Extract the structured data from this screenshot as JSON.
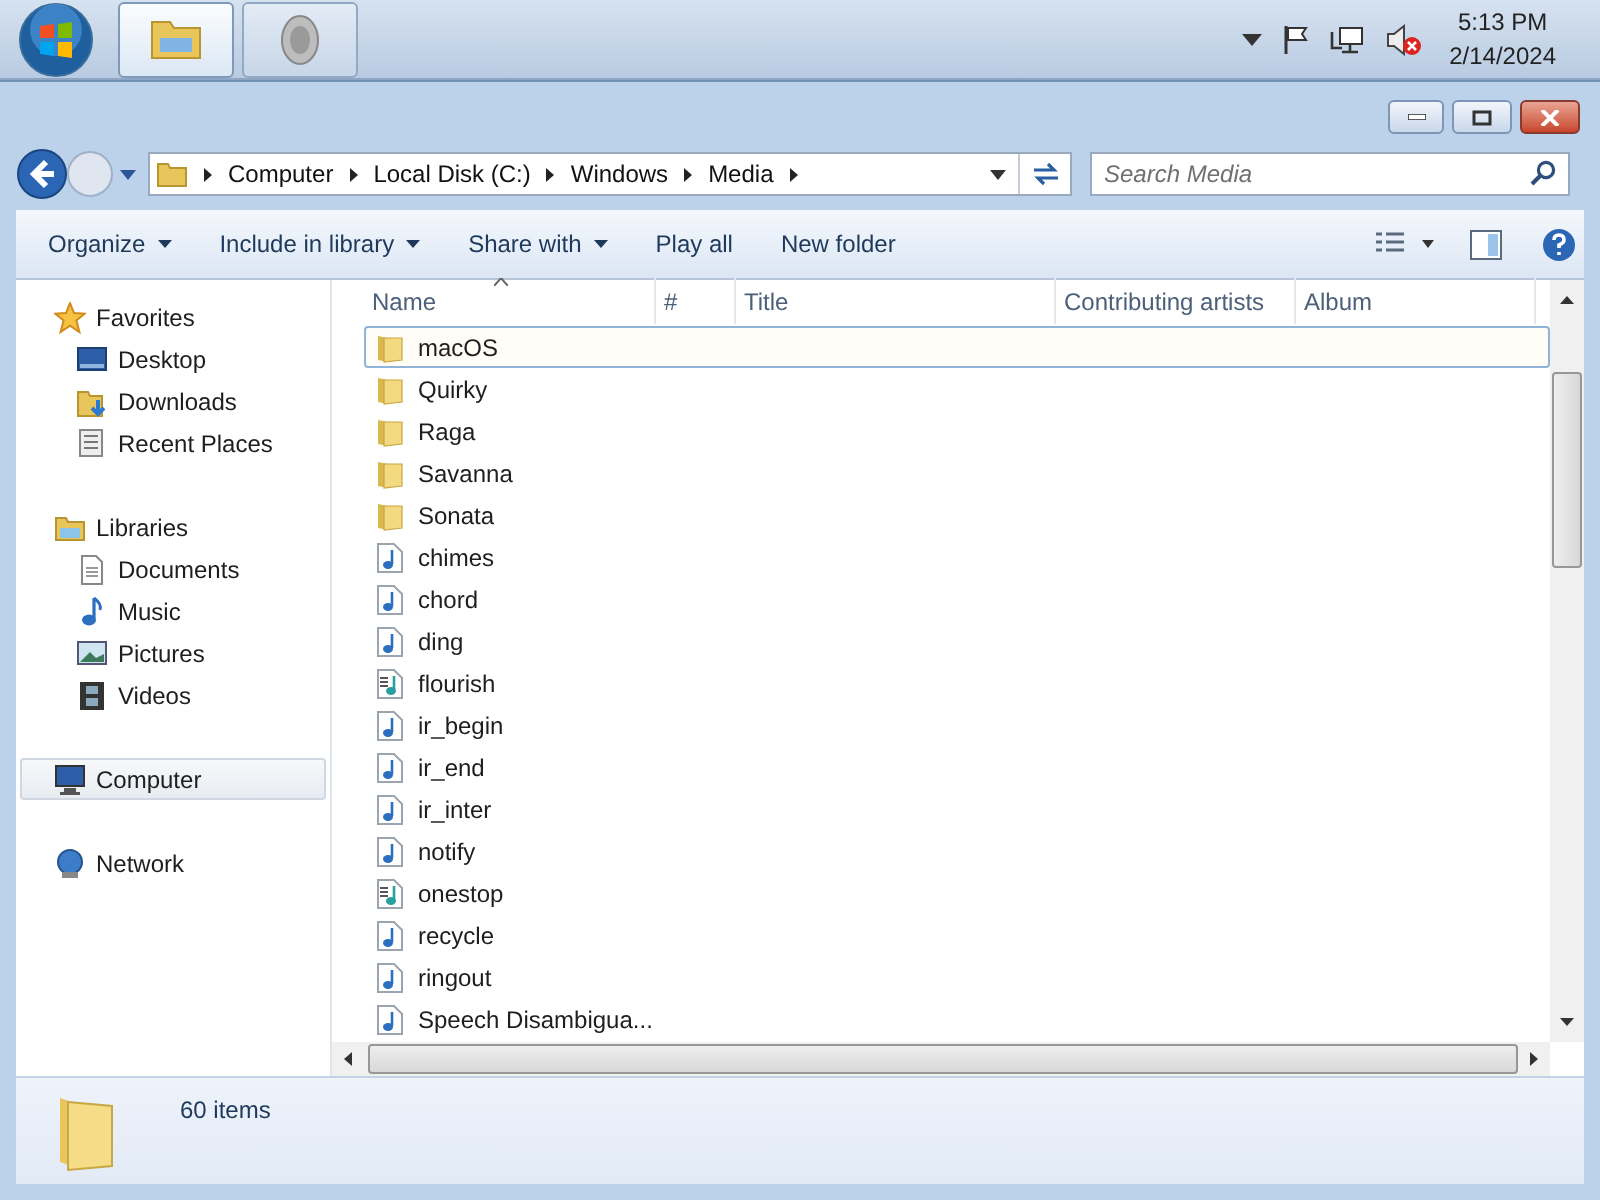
{
  "taskbar": {
    "buttons": [
      {
        "kind": "explorer",
        "active": true
      },
      {
        "kind": "speaker",
        "active": false
      }
    ],
    "clock": {
      "time": "5:13 PM",
      "date": "2/14/2024"
    }
  },
  "breadcrumb": [
    "Computer",
    "Local Disk (C:)",
    "Windows",
    "Media"
  ],
  "search": {
    "placeholder": "Search Media"
  },
  "toolbar": {
    "buttons": [
      {
        "label": "Organize",
        "dropdown": true
      },
      {
        "label": "Include in library",
        "dropdown": true
      },
      {
        "label": "Share with",
        "dropdown": true
      },
      {
        "label": "Play all",
        "dropdown": false
      },
      {
        "label": "New folder",
        "dropdown": false
      }
    ]
  },
  "sidebar": {
    "groups": [
      {
        "label": "Favorites",
        "kind": "star",
        "selected": false,
        "children": [
          {
            "label": "Desktop",
            "kind": "desktop"
          },
          {
            "label": "Downloads",
            "kind": "downloads"
          },
          {
            "label": "Recent Places",
            "kind": "recent"
          }
        ]
      },
      {
        "label": "Libraries",
        "kind": "libraries",
        "selected": false,
        "children": [
          {
            "label": "Documents",
            "kind": "document"
          },
          {
            "label": "Music",
            "kind": "music"
          },
          {
            "label": "Pictures",
            "kind": "pictures"
          },
          {
            "label": "Videos",
            "kind": "videos"
          }
        ]
      },
      {
        "label": "Computer",
        "kind": "computer",
        "selected": true
      },
      {
        "label": "Network",
        "kind": "network",
        "selected": false
      }
    ]
  },
  "columns": [
    {
      "label": "Name",
      "sorted": true
    },
    {
      "label": "#",
      "sorted": false
    },
    {
      "label": "Title",
      "sorted": false
    },
    {
      "label": "Contributing artists",
      "sorted": false
    },
    {
      "label": "Album",
      "sorted": false
    }
  ],
  "files": [
    {
      "name": "macOS",
      "kind": "folder",
      "focused": true
    },
    {
      "name": "Quirky",
      "kind": "folder",
      "focused": false
    },
    {
      "name": "Raga",
      "kind": "folder",
      "focused": false
    },
    {
      "name": "Savanna",
      "kind": "folder",
      "focused": false
    },
    {
      "name": "Sonata",
      "kind": "folder",
      "focused": false
    },
    {
      "name": "chimes",
      "kind": "audio",
      "focused": false
    },
    {
      "name": "chord",
      "kind": "audio",
      "focused": false
    },
    {
      "name": "ding",
      "kind": "audio",
      "focused": false
    },
    {
      "name": "flourish",
      "kind": "midi",
      "focused": false
    },
    {
      "name": "ir_begin",
      "kind": "audio",
      "focused": false
    },
    {
      "name": "ir_end",
      "kind": "audio",
      "focused": false
    },
    {
      "name": "ir_inter",
      "kind": "audio",
      "focused": false
    },
    {
      "name": "notify",
      "kind": "audio",
      "focused": false
    },
    {
      "name": "onestop",
      "kind": "midi",
      "focused": false
    },
    {
      "name": "recycle",
      "kind": "audio",
      "focused": false
    },
    {
      "name": "ringout",
      "kind": "audio",
      "focused": false
    },
    {
      "name": "Speech Disambigua...",
      "kind": "audio",
      "focused": false
    }
  ],
  "details": {
    "count": "60 items"
  }
}
